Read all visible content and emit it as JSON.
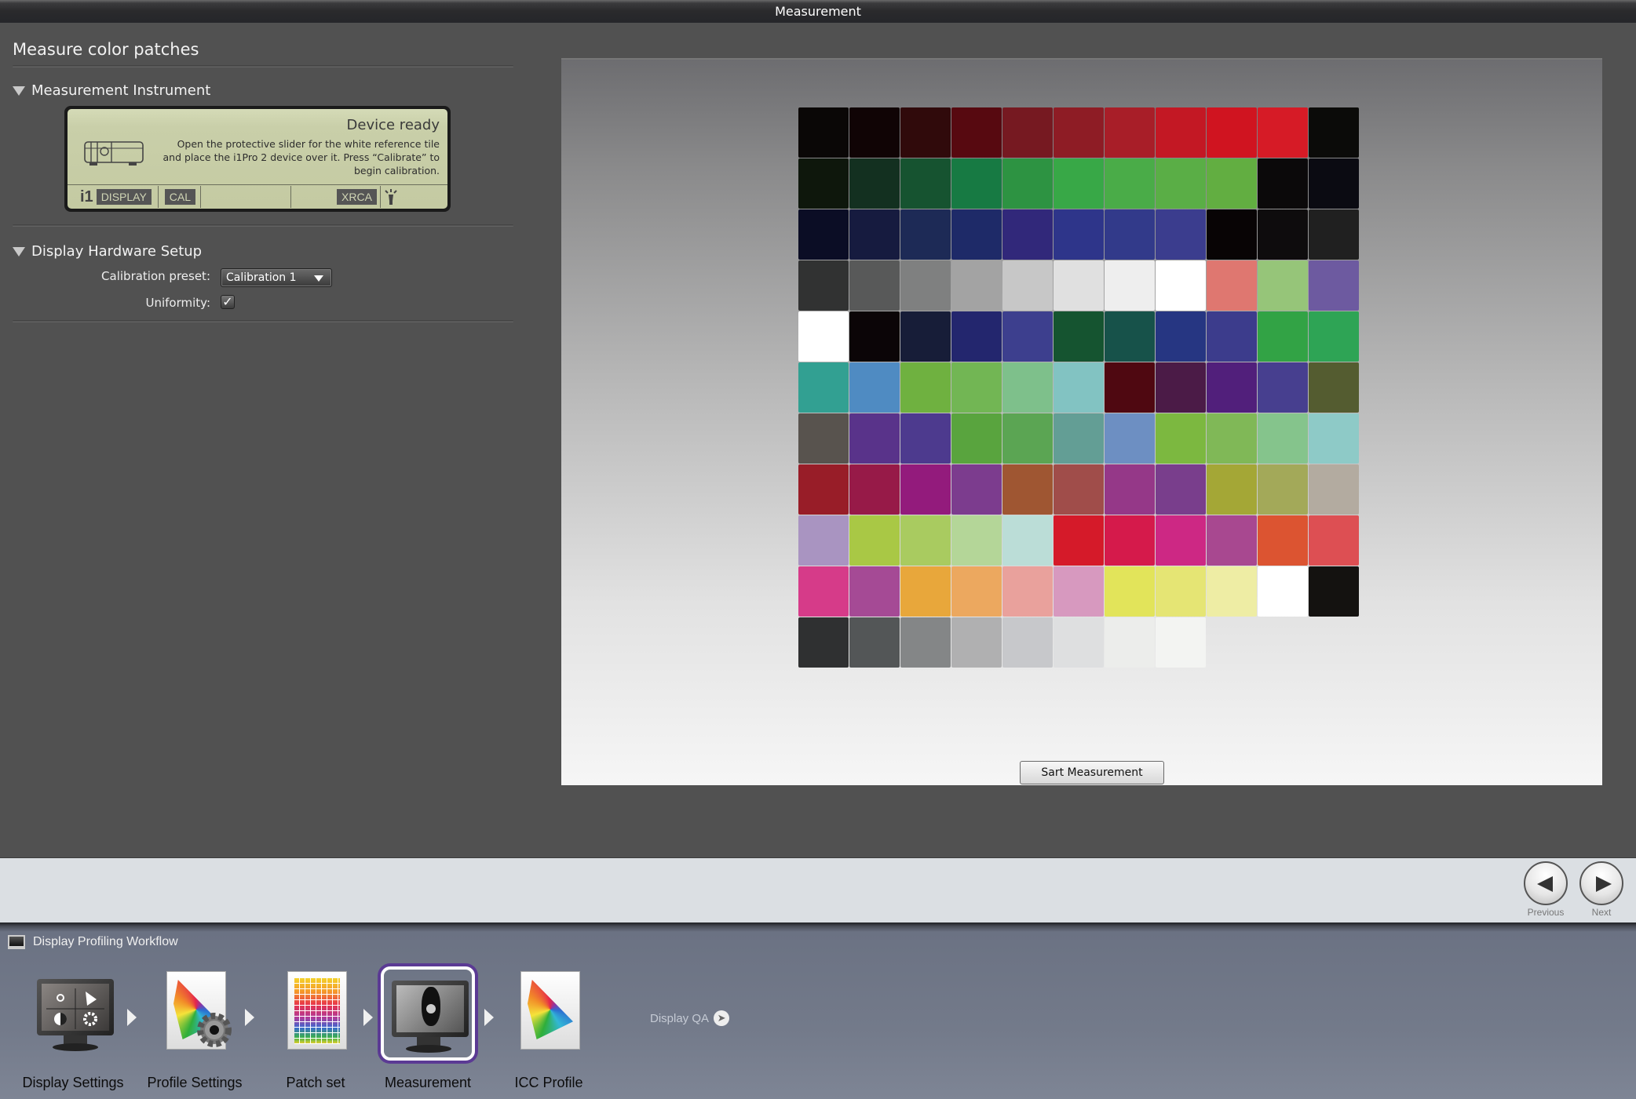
{
  "window": {
    "title": "Measurement"
  },
  "left_panel": {
    "title": "Measure color patches",
    "instrument_section": {
      "heading": "Measurement Instrument",
      "device": {
        "status": "Device ready",
        "message": "Open the protective slider for the white reference tile and place the i1Pro 2 device over it. Press “Calibrate” to begin calibration.",
        "brand": "i1",
        "tags": [
          "DISPLAY",
          "CAL",
          "XRCA"
        ],
        "icons": [
          "spectrophotometer-icon",
          "lamp-icon"
        ]
      }
    },
    "hardware_section": {
      "heading": "Display Hardware Setup",
      "calibration_preset_label": "Calibration preset:",
      "calibration_preset_value": "Calibration 1",
      "uniformity_label": "Uniformity:",
      "uniformity_checked": true,
      "checkmark": "✓"
    }
  },
  "preview": {
    "patches": [
      [
        "#0a0706",
        "#100405",
        "#300a0b",
        "#570910",
        "#761921",
        "#8e1c25",
        "#a81e28",
        "#c31824",
        "#d01420",
        "#d61b26",
        "#0b0b09"
      ],
      [
        "#0e170c",
        "#133020",
        "#165330",
        "#177a43",
        "#2d9342",
        "#38a847",
        "#4aac48",
        "#5aae46",
        "#62ae41",
        "#0b090a",
        "#0b0b12"
      ],
      [
        "#0b0d25",
        "#161b3f",
        "#1d2a56",
        "#1e2a68",
        "#31287a",
        "#2e358a",
        "#323a8a",
        "#3b3d8e",
        "#080405",
        "#0e0c0d",
        "#202020"
      ],
      [
        "#313232",
        "#585959",
        "#7f8080",
        "#a3a3a3",
        "#c7c7c7",
        "#e0e0e0",
        "#eeeeee",
        "#ffffff",
        "#df7770",
        "#96c579",
        "#6d5aa0"
      ],
      [
        "#ffffff",
        "#0b0507",
        "#171d38",
        "#23266e",
        "#3d3f8e",
        "#155430",
        "#17524a",
        "#263682",
        "#3c3c8c",
        "#32a345",
        "#2ea455"
      ],
      [
        "#32a092",
        "#4f8bc2",
        "#6fb140",
        "#72b654",
        "#7ec08b",
        "#82c3c2",
        "#4f0811",
        "#4b1b47",
        "#511f7b",
        "#473f8f",
        "#545c30"
      ],
      [
        "#58534e",
        "#59338a",
        "#4d3a8e",
        "#59a43e",
        "#5ba553",
        "#639e95",
        "#6d8fc2",
        "#7cb840",
        "#80b857",
        "#85c48c",
        "#8ecac7"
      ],
      [
        "#981d28",
        "#971a48",
        "#931b7c",
        "#7c3c8e",
        "#9f5632",
        "#a04d4a",
        "#953888",
        "#793e8c",
        "#a4a736",
        "#a3a959",
        "#b3aba0"
      ],
      [
        "#a994c1",
        "#a9c845",
        "#a9cb60",
        "#b4d698",
        "#bbddd7",
        "#d51a29",
        "#d51a4b",
        "#cd2884",
        "#a84890",
        "#dc5431",
        "#dd4f53"
      ],
      [
        "#d63b89",
        "#a54a95",
        "#e8a73b",
        "#eca85f",
        "#e9a19c",
        "#d799bf",
        "#e2e45a",
        "#e5e574",
        "#eeeda4",
        "#ffffff",
        "#141210"
      ],
      [
        "#2f3031",
        "#535657",
        "#848687",
        "#b0b0b1",
        "#c7c8cb",
        "#dedfe0",
        "#ecedeb",
        "#f3f4f2"
      ]
    ],
    "start_button_label": "Sart Measurement"
  },
  "navigation": {
    "previous_label": "Previous",
    "next_label": "Next"
  },
  "workflow": {
    "title": "Display Profiling Workflow",
    "steps": [
      {
        "label": "Display Settings",
        "icon": "display-settings-icon",
        "active": false
      },
      {
        "label": "Profile Settings",
        "icon": "profile-settings-icon",
        "active": false
      },
      {
        "label": "Patch set",
        "icon": "patch-set-icon",
        "active": false
      },
      {
        "label": "Measurement",
        "icon": "measurement-icon",
        "active": true
      },
      {
        "label": "ICC Profile",
        "icon": "icc-profile-icon",
        "active": false
      }
    ],
    "next_module_label": "Display QA",
    "active_color": "#5b3a94"
  }
}
